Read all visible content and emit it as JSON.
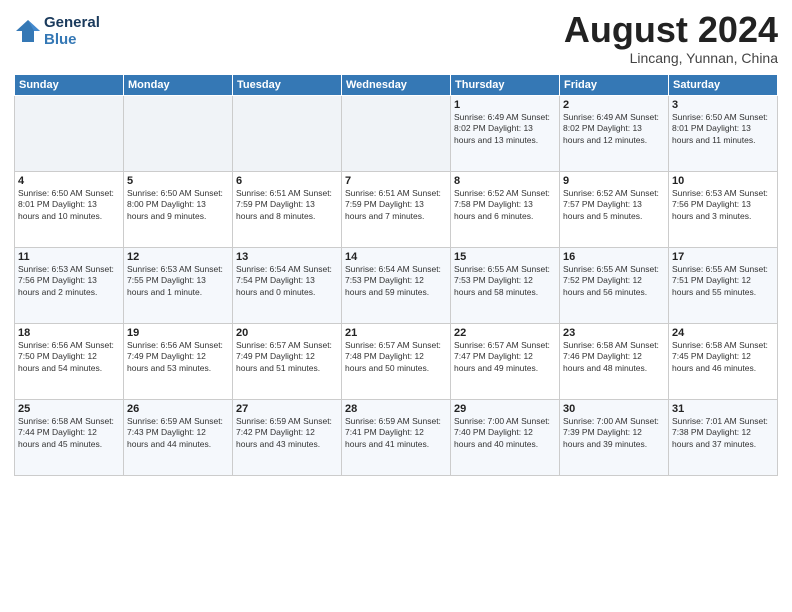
{
  "header": {
    "logo_line1": "General",
    "logo_line2": "Blue",
    "month_title": "August 2024",
    "subtitle": "Lincang, Yunnan, China"
  },
  "weekdays": [
    "Sunday",
    "Monday",
    "Tuesday",
    "Wednesday",
    "Thursday",
    "Friday",
    "Saturday"
  ],
  "weeks": [
    [
      {
        "day": "",
        "info": ""
      },
      {
        "day": "",
        "info": ""
      },
      {
        "day": "",
        "info": ""
      },
      {
        "day": "",
        "info": ""
      },
      {
        "day": "1",
        "info": "Sunrise: 6:49 AM\nSunset: 8:02 PM\nDaylight: 13 hours\nand 13 minutes."
      },
      {
        "day": "2",
        "info": "Sunrise: 6:49 AM\nSunset: 8:02 PM\nDaylight: 13 hours\nand 12 minutes."
      },
      {
        "day": "3",
        "info": "Sunrise: 6:50 AM\nSunset: 8:01 PM\nDaylight: 13 hours\nand 11 minutes."
      }
    ],
    [
      {
        "day": "4",
        "info": "Sunrise: 6:50 AM\nSunset: 8:01 PM\nDaylight: 13 hours\nand 10 minutes."
      },
      {
        "day": "5",
        "info": "Sunrise: 6:50 AM\nSunset: 8:00 PM\nDaylight: 13 hours\nand 9 minutes."
      },
      {
        "day": "6",
        "info": "Sunrise: 6:51 AM\nSunset: 7:59 PM\nDaylight: 13 hours\nand 8 minutes."
      },
      {
        "day": "7",
        "info": "Sunrise: 6:51 AM\nSunset: 7:59 PM\nDaylight: 13 hours\nand 7 minutes."
      },
      {
        "day": "8",
        "info": "Sunrise: 6:52 AM\nSunset: 7:58 PM\nDaylight: 13 hours\nand 6 minutes."
      },
      {
        "day": "9",
        "info": "Sunrise: 6:52 AM\nSunset: 7:57 PM\nDaylight: 13 hours\nand 5 minutes."
      },
      {
        "day": "10",
        "info": "Sunrise: 6:53 AM\nSunset: 7:56 PM\nDaylight: 13 hours\nand 3 minutes."
      }
    ],
    [
      {
        "day": "11",
        "info": "Sunrise: 6:53 AM\nSunset: 7:56 PM\nDaylight: 13 hours\nand 2 minutes."
      },
      {
        "day": "12",
        "info": "Sunrise: 6:53 AM\nSunset: 7:55 PM\nDaylight: 13 hours\nand 1 minute."
      },
      {
        "day": "13",
        "info": "Sunrise: 6:54 AM\nSunset: 7:54 PM\nDaylight: 13 hours\nand 0 minutes."
      },
      {
        "day": "14",
        "info": "Sunrise: 6:54 AM\nSunset: 7:53 PM\nDaylight: 12 hours\nand 59 minutes."
      },
      {
        "day": "15",
        "info": "Sunrise: 6:55 AM\nSunset: 7:53 PM\nDaylight: 12 hours\nand 58 minutes."
      },
      {
        "day": "16",
        "info": "Sunrise: 6:55 AM\nSunset: 7:52 PM\nDaylight: 12 hours\nand 56 minutes."
      },
      {
        "day": "17",
        "info": "Sunrise: 6:55 AM\nSunset: 7:51 PM\nDaylight: 12 hours\nand 55 minutes."
      }
    ],
    [
      {
        "day": "18",
        "info": "Sunrise: 6:56 AM\nSunset: 7:50 PM\nDaylight: 12 hours\nand 54 minutes."
      },
      {
        "day": "19",
        "info": "Sunrise: 6:56 AM\nSunset: 7:49 PM\nDaylight: 12 hours\nand 53 minutes."
      },
      {
        "day": "20",
        "info": "Sunrise: 6:57 AM\nSunset: 7:49 PM\nDaylight: 12 hours\nand 51 minutes."
      },
      {
        "day": "21",
        "info": "Sunrise: 6:57 AM\nSunset: 7:48 PM\nDaylight: 12 hours\nand 50 minutes."
      },
      {
        "day": "22",
        "info": "Sunrise: 6:57 AM\nSunset: 7:47 PM\nDaylight: 12 hours\nand 49 minutes."
      },
      {
        "day": "23",
        "info": "Sunrise: 6:58 AM\nSunset: 7:46 PM\nDaylight: 12 hours\nand 48 minutes."
      },
      {
        "day": "24",
        "info": "Sunrise: 6:58 AM\nSunset: 7:45 PM\nDaylight: 12 hours\nand 46 minutes."
      }
    ],
    [
      {
        "day": "25",
        "info": "Sunrise: 6:58 AM\nSunset: 7:44 PM\nDaylight: 12 hours\nand 45 minutes."
      },
      {
        "day": "26",
        "info": "Sunrise: 6:59 AM\nSunset: 7:43 PM\nDaylight: 12 hours\nand 44 minutes."
      },
      {
        "day": "27",
        "info": "Sunrise: 6:59 AM\nSunset: 7:42 PM\nDaylight: 12 hours\nand 43 minutes."
      },
      {
        "day": "28",
        "info": "Sunrise: 6:59 AM\nSunset: 7:41 PM\nDaylight: 12 hours\nand 41 minutes."
      },
      {
        "day": "29",
        "info": "Sunrise: 7:00 AM\nSunset: 7:40 PM\nDaylight: 12 hours\nand 40 minutes."
      },
      {
        "day": "30",
        "info": "Sunrise: 7:00 AM\nSunset: 7:39 PM\nDaylight: 12 hours\nand 39 minutes."
      },
      {
        "day": "31",
        "info": "Sunrise: 7:01 AM\nSunset: 7:38 PM\nDaylight: 12 hours\nand 37 minutes."
      }
    ]
  ]
}
